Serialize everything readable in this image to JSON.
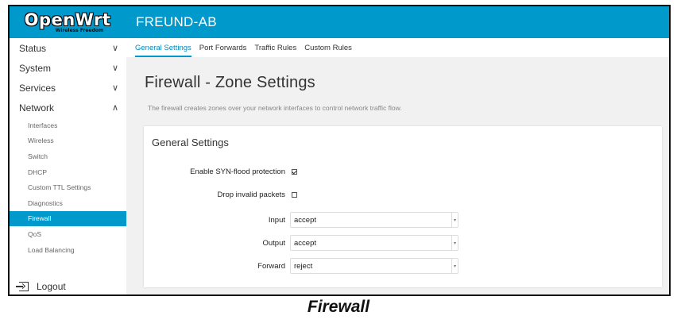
{
  "logo": {
    "main": "OpenWrt",
    "sub": "Wireless Freedom"
  },
  "header": {
    "title": "FREUND-AB"
  },
  "tabs": [
    {
      "label": "General Settings",
      "active": true
    },
    {
      "label": "Port Forwards",
      "active": false
    },
    {
      "label": "Traffic Rules",
      "active": false
    },
    {
      "label": "Custom Rules",
      "active": false
    }
  ],
  "sidebar": {
    "menu": [
      {
        "label": "Status",
        "chevron": "∨"
      },
      {
        "label": "System",
        "chevron": "∨"
      },
      {
        "label": "Services",
        "chevron": "∨"
      },
      {
        "label": "Network",
        "chevron": "∧"
      }
    ],
    "network_items": [
      {
        "label": "Interfaces"
      },
      {
        "label": "Wireless"
      },
      {
        "label": "Switch"
      },
      {
        "label": "DHCP"
      },
      {
        "label": "Custom TTL Settings"
      },
      {
        "label": "Diagnostics"
      },
      {
        "label": "Firewall",
        "active": true
      },
      {
        "label": "QoS"
      },
      {
        "label": "Load Balancing"
      }
    ],
    "logout": "Logout"
  },
  "page": {
    "title": "Firewall - Zone Settings",
    "description": "The firewall creates zones over your network interfaces to control network traffic flow."
  },
  "general_settings": {
    "title": "General Settings",
    "syn_flood": {
      "label": "Enable SYN-flood protection",
      "checked": true
    },
    "drop_invalid": {
      "label": "Drop invalid packets",
      "checked": false
    },
    "input": {
      "label": "Input",
      "value": "accept"
    },
    "output": {
      "label": "Output",
      "value": "accept"
    },
    "forward": {
      "label": "Forward",
      "value": "reject"
    }
  },
  "caption": "Firewall",
  "colors": {
    "accent": "#0099cc",
    "sidebar_bg": "#ffffff",
    "content_bg": "#f1f1f1"
  }
}
